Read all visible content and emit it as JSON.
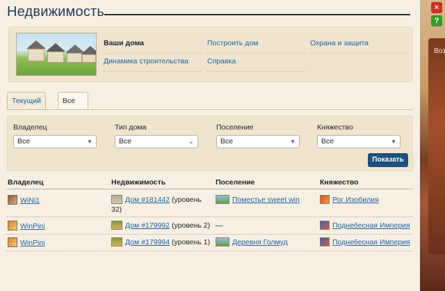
{
  "header": {
    "title": "Недвижимость"
  },
  "side_buttons": {
    "close": "×",
    "help": "?"
  },
  "side_panel": {
    "text": "Воз"
  },
  "top_menu": {
    "col1": [
      "Ваши дома",
      "Динамика строительства"
    ],
    "col2": [
      "Построить дом",
      "Справка"
    ],
    "col3": [
      "Охрана и защита"
    ]
  },
  "tabs": [
    {
      "label": "Текущий клон",
      "active": false
    },
    {
      "label": "Все клоны",
      "active": true
    }
  ],
  "filters": {
    "owner": {
      "label": "Владелец",
      "value": "Все"
    },
    "house_type": {
      "label": "Тип дома",
      "value": "Все"
    },
    "settlement": {
      "label": "Поселение",
      "value": "Все"
    },
    "principality": {
      "label": "Княжество",
      "value": "Все"
    },
    "show_button": "Показать"
  },
  "table": {
    "headers": [
      "Владелец",
      "Недвижимость",
      "Поселение",
      "Княжество"
    ],
    "rows": [
      {
        "owner": "WiNi1",
        "property_link": "Дом #181442",
        "property_level": "(уровень",
        "property_level2": "32)",
        "settlement": "Поместье sweet win",
        "principality": "Рог Изобилия"
      },
      {
        "owner": "WinPini",
        "property_link": "Дом #179992",
        "property_level": "(уровень 2)",
        "settlement": "—",
        "principality": "Поднебесная Империя"
      },
      {
        "owner": "WinPini",
        "property_link": "Дом #179994",
        "property_level": "(уровень 1)",
        "settlement": "Деревня Голмуд",
        "principality": "Поднебесная Империя"
      }
    ]
  },
  "colors": {
    "accent": "#1d5f9a",
    "button": "#1f4f7c",
    "title": "#1f3d5b"
  }
}
